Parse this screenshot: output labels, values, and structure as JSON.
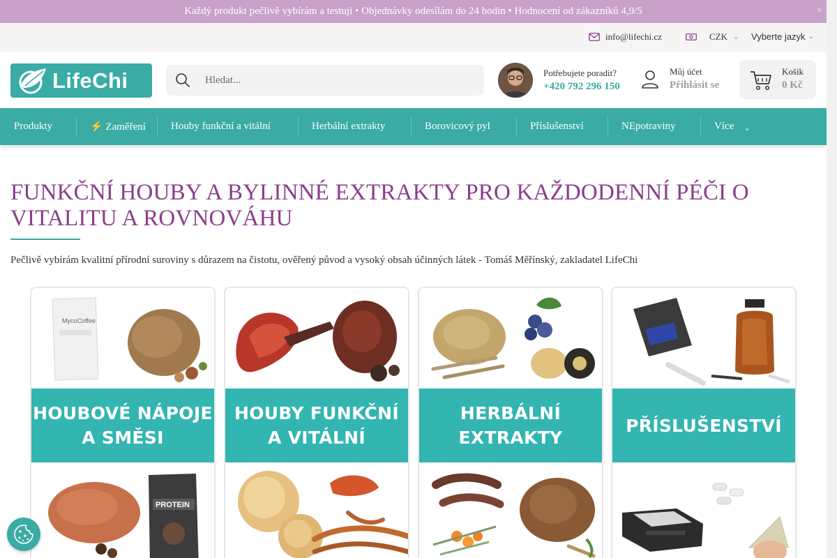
{
  "announcement": {
    "text": "Každý produkt pečlivě vybírám a testuji • Objednávky odesílám do 24 hodin • Hodnocení od zákazníků 4,9/5",
    "close": "×"
  },
  "utility": {
    "email": "info@lifechi.cz",
    "currency": "CZK",
    "language": "Vyberte jazyk"
  },
  "header": {
    "logo_text": "LifeChi",
    "search_placeholder": "Hledat...",
    "contact_label": "Potřebujete poradit?",
    "contact_phone": "+420 792 296 150",
    "account_label": "Můj účet",
    "account_login": "Přihlásit se",
    "cart_label": "Košík",
    "cart_total": "0 Kč"
  },
  "nav": {
    "items": [
      {
        "label": " Produkty"
      },
      {
        "label": "⚡ Zaměření"
      },
      {
        "label": " Houby funkční a vitální"
      },
      {
        "label": " Herbální extrakty"
      },
      {
        "label": " Borovicový pyl"
      },
      {
        "label": " Příslušenství"
      },
      {
        "label": " NEpotraviny"
      },
      {
        "label": "Více"
      }
    ]
  },
  "hero": {
    "title": "FUNKČNÍ HOUBY A BYLINNÉ EXTRAKTY PRO KAŽDODENNÍ PÉČI O VITALITU A ROVNOVÁHU",
    "subtitle": "Pečlivě vybírám kvalitní přírodní suroviny s důrazem na čistotu, ověřený původ a vysoký obsah účinných látek - Tomáš Měřínský, zakladatel LifeChi"
  },
  "categories": [
    {
      "label": "HOUBOVÉ NÁPOJE\nA SMĚSI",
      "product_label_top": "MycoCoffee",
      "product_label_bottom": "PROTEIN"
    },
    {
      "label": "HOUBY FUNKČNÍ\nA VITÁLNÍ"
    },
    {
      "label": "HERBÁLNÍ\nEXTRAKTY"
    },
    {
      "label": "PŘÍSLUŠENSTVÍ"
    }
  ],
  "colors": {
    "brand_teal": "#3aaba5",
    "band_teal": "#33b5b1",
    "announce_bg": "#c9a1c9",
    "title_purple": "#8a3d8a"
  },
  "icons": {
    "email": "envelope-icon",
    "currency": "banknote-icon",
    "search": "magnifier-icon",
    "account": "user-icon",
    "cart": "cart-icon",
    "cookie": "cookie-icon"
  }
}
